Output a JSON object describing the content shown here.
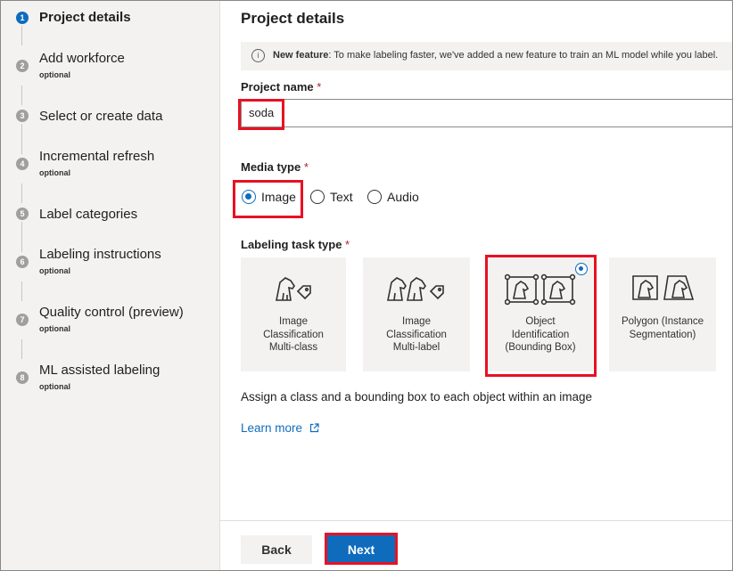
{
  "sidebar": {
    "steps": [
      {
        "num": "1",
        "label": "Project details",
        "optional": ""
      },
      {
        "num": "2",
        "label": "Add workforce",
        "optional": "optional"
      },
      {
        "num": "3",
        "label": "Select or create data",
        "optional": ""
      },
      {
        "num": "4",
        "label": "Incremental refresh",
        "optional": "optional"
      },
      {
        "num": "5",
        "label": "Label categories",
        "optional": ""
      },
      {
        "num": "6",
        "label": "Labeling instructions",
        "optional": "optional"
      },
      {
        "num": "7",
        "label": "Quality control (preview)",
        "optional": "optional"
      },
      {
        "num": "8",
        "label": "ML assisted labeling",
        "optional": "optional"
      }
    ]
  },
  "main": {
    "title": "Project details",
    "banner": {
      "bold": "New feature",
      "text": ": To make labeling faster, we've added a new feature to train an ML model while you label."
    },
    "project_name": {
      "label": "Project name",
      "required": "*",
      "value": "soda"
    },
    "media_type": {
      "label": "Media type",
      "required": "*",
      "options": [
        "Image",
        "Text",
        "Audio"
      ],
      "selected": "Image"
    },
    "task_type": {
      "label": "Labeling task type",
      "required": "*",
      "cards": [
        {
          "line1": "Image",
          "line2": "Classification",
          "line3": "Multi-class",
          "icon": "dog-tag-icon"
        },
        {
          "line1": "Image",
          "line2": "Classification",
          "line3": "Multi-label",
          "icon": "two-dogs-tag-icon"
        },
        {
          "line1": "Object",
          "line2": "Identification",
          "line3": "(Bounding Box)",
          "icon": "bounding-box-icon"
        },
        {
          "line1": "Polygon (Instance",
          "line2": "Segmentation)",
          "line3": "",
          "icon": "polygon-icon"
        }
      ],
      "selected": "Object Identification (Bounding Box)"
    },
    "description": "Assign a class and a bounding box to each object within an image",
    "learn_more": "Learn more"
  },
  "footer": {
    "back_label": "Back",
    "next_label": "Next"
  },
  "colors": {
    "accent": "#0f6cbd",
    "highlight": "#e81123",
    "required": "#a4262c"
  }
}
